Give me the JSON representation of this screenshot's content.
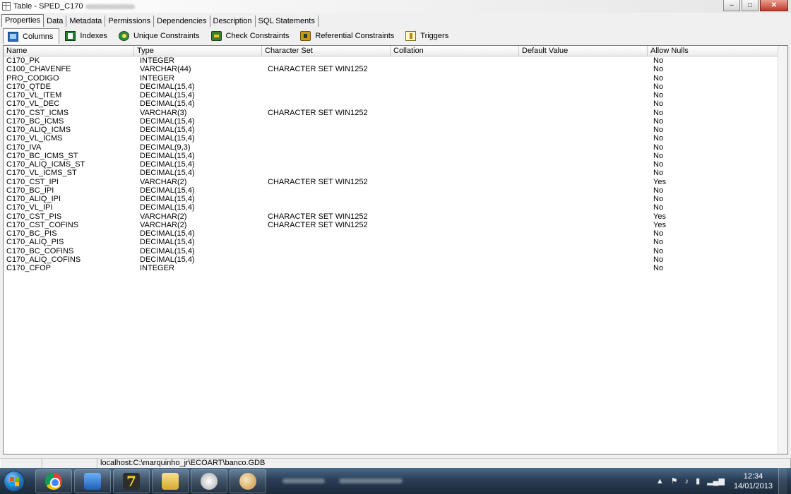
{
  "window": {
    "title": "Table - SPED_C170"
  },
  "tabs": [
    "Properties",
    "Data",
    "Metadata",
    "Permissions",
    "Dependencies",
    "Description",
    "SQL Statements"
  ],
  "subtabs": [
    "Columns",
    "Indexes",
    "Unique Constraints",
    "Check Constraints",
    "Referential Constraints",
    "Triggers"
  ],
  "grid": {
    "headers": [
      "Name",
      "Type",
      "Character Set",
      "Collation",
      "Default Value",
      "Allow Nulls"
    ],
    "rows": [
      [
        "C170_PK",
        "INTEGER",
        "",
        "",
        "",
        "No"
      ],
      [
        "C100_CHAVENFE",
        "VARCHAR(44)",
        "CHARACTER SET WIN1252",
        "",
        "",
        "No"
      ],
      [
        "PRO_CODIGO",
        "INTEGER",
        "",
        "",
        "",
        "No"
      ],
      [
        "C170_QTDE",
        "DECIMAL(15,4)",
        "",
        "",
        "",
        "No"
      ],
      [
        "C170_VL_ITEM",
        "DECIMAL(15,4)",
        "",
        "",
        "",
        "No"
      ],
      [
        "C170_VL_DEC",
        "DECIMAL(15,4)",
        "",
        "",
        "",
        "No"
      ],
      [
        "C170_CST_ICMS",
        "VARCHAR(3)",
        "CHARACTER SET WIN1252",
        "",
        "",
        "No"
      ],
      [
        "C170_BC_ICMS",
        "DECIMAL(15,4)",
        "",
        "",
        "",
        "No"
      ],
      [
        "C170_ALIQ_ICMS",
        "DECIMAL(15,4)",
        "",
        "",
        "",
        "No"
      ],
      [
        "C170_VL_ICMS",
        "DECIMAL(15,4)",
        "",
        "",
        "",
        "No"
      ],
      [
        "C170_IVA",
        "DECIMAL(9,3)",
        "",
        "",
        "",
        "No"
      ],
      [
        "C170_BC_ICMS_ST",
        "DECIMAL(15,4)",
        "",
        "",
        "",
        "No"
      ],
      [
        "C170_ALIQ_ICMS_ST",
        "DECIMAL(15,4)",
        "",
        "",
        "",
        "No"
      ],
      [
        "C170_VL_ICMS_ST",
        "DECIMAL(15,4)",
        "",
        "",
        "",
        "No"
      ],
      [
        "C170_CST_IPI",
        "VARCHAR(2)",
        "CHARACTER SET WIN1252",
        "",
        "",
        "Yes"
      ],
      [
        "C170_BC_IPI",
        "DECIMAL(15,4)",
        "",
        "",
        "",
        "No"
      ],
      [
        "C170_ALIQ_IPI",
        "DECIMAL(15,4)",
        "",
        "",
        "",
        "No"
      ],
      [
        "C170_VL_IPI",
        "DECIMAL(15,4)",
        "",
        "",
        "",
        "No"
      ],
      [
        "C170_CST_PIS",
        "VARCHAR(2)",
        "CHARACTER SET WIN1252",
        "",
        "",
        "Yes"
      ],
      [
        "C170_CST_COFINS",
        "VARCHAR(2)",
        "CHARACTER SET WIN1252",
        "",
        "",
        "Yes"
      ],
      [
        "C170_BC_PIS",
        "DECIMAL(15,4)",
        "",
        "",
        "",
        "No"
      ],
      [
        "C170_ALIQ_PIS",
        "DECIMAL(15,4)",
        "",
        "",
        "",
        "No"
      ],
      [
        "C170_BC_COFINS",
        "DECIMAL(15,4)",
        "",
        "",
        "",
        "No"
      ],
      [
        "C170_ALIQ_COFINS",
        "DECIMAL(15,4)",
        "",
        "",
        "",
        "No"
      ],
      [
        "C170_CFOP",
        "INTEGER",
        "",
        "",
        "",
        "No"
      ]
    ]
  },
  "statusbar": {
    "path": "localhost:C:\\marquinho_jr\\ECOART\\banco.GDB"
  },
  "taskbar": {
    "time": "12:34",
    "date": "14/01/2013",
    "pinned": [
      "chrome-icon",
      "remote-desktop-icon",
      "app-7-icon",
      "explorer-icon",
      "database-icon",
      "paint-icon"
    ]
  },
  "icons": {
    "columns": "columns-icon",
    "indexes": "indexes-icon",
    "unique": "unique-constraints-icon",
    "check": "check-constraints-icon",
    "referential": "referential-constraints-icon",
    "triggers": "triggers-icon"
  }
}
